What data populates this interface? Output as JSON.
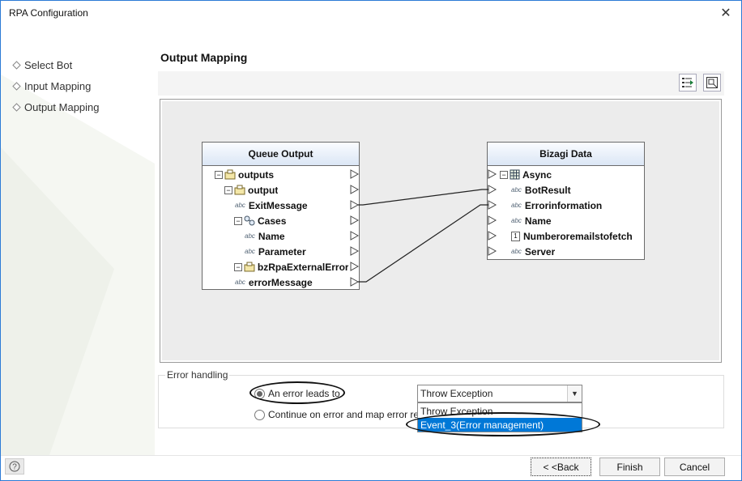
{
  "window": {
    "title": "RPA Configuration",
    "close_glyph": "✕"
  },
  "nav": {
    "items": [
      {
        "label": "Select Bot",
        "icon": "diamond-bullet-icon"
      },
      {
        "label": "Input Mapping",
        "icon": "diamond-bullet-icon"
      },
      {
        "label": "Output Mapping",
        "icon": "diamond-bullet-icon"
      }
    ]
  },
  "content": {
    "title": "Output Mapping"
  },
  "toolbar": {
    "buttons": [
      "auto-map-icon",
      "layout-icon"
    ]
  },
  "mapping": {
    "source": {
      "title": "Queue Output",
      "rows": [
        {
          "label": "outputs",
          "icon": "object-icon"
        },
        {
          "label": "output",
          "icon": "object-icon"
        },
        {
          "label": "ExitMessage",
          "icon": "abc-icon",
          "icon_text": "abc"
        },
        {
          "label": "Cases",
          "icon": "collection-icon"
        },
        {
          "label": "Name",
          "icon": "abc-icon",
          "icon_text": "abc"
        },
        {
          "label": "Parameter",
          "icon": "abc-icon",
          "icon_text": "abc"
        },
        {
          "label": "bzRpaExternalError",
          "icon": "object-icon"
        },
        {
          "label": "errorMessage",
          "icon": "abc-icon",
          "icon_text": "abc"
        }
      ]
    },
    "target": {
      "title": "Bizagi Data",
      "rows": [
        {
          "label": "Async",
          "icon": "table-icon"
        },
        {
          "label": "BotResult",
          "icon": "abc-icon",
          "icon_text": "abc"
        },
        {
          "label": "Errorinformation",
          "icon": "abc-icon",
          "icon_text": "abc"
        },
        {
          "label": "Name",
          "icon": "abc-icon",
          "icon_text": "abc"
        },
        {
          "label": "Numberoremailstofetch",
          "icon": "number-icon",
          "icon_text": "1"
        },
        {
          "label": "Server",
          "icon": "abc-icon",
          "icon_text": "abc"
        }
      ]
    },
    "connections": [
      {
        "from": "ExitMessage",
        "to": "BotResult"
      },
      {
        "from": "errorMessage",
        "to": "Errorinformation"
      }
    ]
  },
  "error_handling": {
    "legend": "Error handling",
    "option_error": "An error leads to",
    "option_continue": "Continue on error and map error resp",
    "selected_value": "Throw Exception",
    "dropdown_options": [
      "Throw Exception",
      "Event_3(Error management)"
    ],
    "highlighted_option": "Event_3(Error management)"
  },
  "footer": {
    "help_glyph": "?",
    "back_label": "< <Back",
    "finish_label": "Finish",
    "cancel_label": "Cancel"
  },
  "colors": {
    "accent": "#0078d7",
    "window_border": "#2b7bd6",
    "node_header": "#dbe6f5"
  }
}
